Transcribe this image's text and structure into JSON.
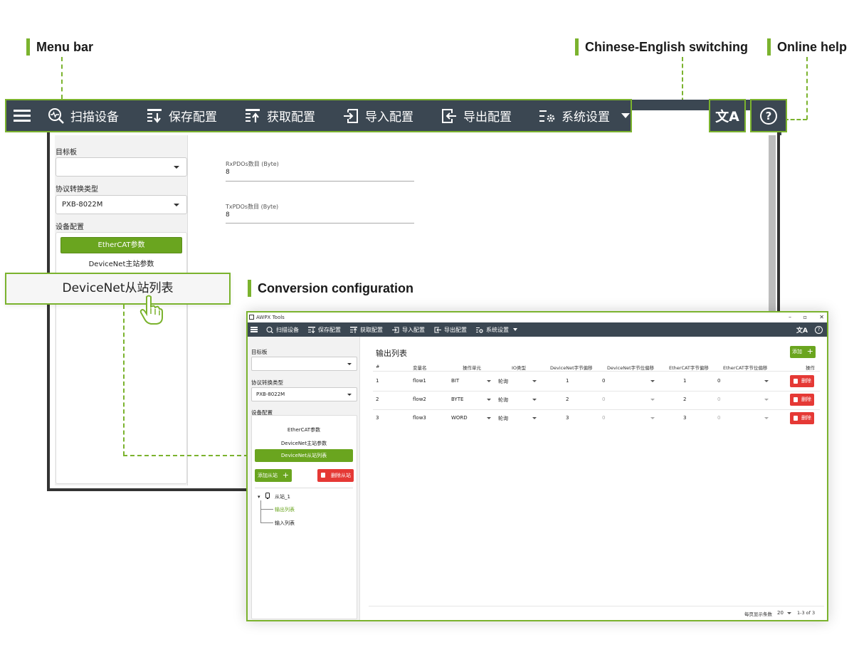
{
  "annotations": {
    "menu_bar": "Menu bar",
    "language": "Chinese-English switching",
    "help": "Online help",
    "conversion": "Conversion configuration"
  },
  "toolbar": {
    "items": [
      "扫描设备",
      "保存配置",
      "获取配置",
      "导入配置",
      "导出配置",
      "系统设置"
    ],
    "translate_glyph": "文A",
    "help_glyph": "?"
  },
  "bg_window": {
    "target_label": "目标板",
    "protocol_label": "协议转换类型",
    "protocol_value": "PXB-8022M",
    "device_config_label": "设备配置",
    "ethercat_btn": "EtherCAT参数",
    "devicenet_master": "DeviceNet主站参数",
    "rx_label": "RxPDOs数目 (Byte)",
    "rx_value": "8",
    "tx_label": "TxPDOs数目 (Byte)",
    "tx_value": "8"
  },
  "callout": {
    "label": "DeviceNet从站列表"
  },
  "inset": {
    "title": "AWPX Tools",
    "window_controls": [
      "–",
      "▫",
      "✕"
    ],
    "toolbar_items": [
      "扫描设备",
      "保存配置",
      "获取配置",
      "导入配置",
      "导出配置",
      "系统设置"
    ],
    "side": {
      "target_label": "目标板",
      "protocol_label": "协议转换类型",
      "protocol_value": "PXB-8022M",
      "device_config_label": "设备配置",
      "ethercat": "EtherCAT参数",
      "devicenet_master": "DeviceNet主站参数",
      "devicenet_slave_list": "DeviceNet从站列表",
      "add_slave": "添加从站",
      "delete_slave": "删除从站",
      "tree_root": "从站_1",
      "tree_output": "输出列表",
      "tree_input": "输入列表"
    },
    "main": {
      "title": "输出列表",
      "add_label": "添加",
      "headers": [
        "#",
        "变量名",
        "操作单元",
        "IO类型",
        "DeviceNet字节偏移",
        "DeviceNet字节位偏移",
        "EtherCAT字节偏移",
        "EtherCAT字节位偏移",
        "操作"
      ],
      "rows": [
        {
          "idx": "1",
          "name": "flow1",
          "unit": "BIT",
          "io": "轮询",
          "dn_byte": "1",
          "dn_bit": "0",
          "ec_byte": "1",
          "ec_bit": "0"
        },
        {
          "idx": "2",
          "name": "flow2",
          "unit": "BYTE",
          "io": "轮询",
          "dn_byte": "2",
          "dn_bit": "0",
          "ec_byte": "2",
          "ec_bit": "0"
        },
        {
          "idx": "3",
          "name": "flow3",
          "unit": "WORD",
          "io": "轮询",
          "dn_byte": "3",
          "dn_bit": "0",
          "ec_byte": "3",
          "ec_bit": "0"
        }
      ],
      "delete_label": "删除",
      "footer_rows_label": "每页显示条数",
      "footer_rows_value": "20",
      "footer_range": "1-3 of 3"
    }
  },
  "colors": {
    "accent": "#7bb32e",
    "bar": "#3b4752",
    "green_btn": "#6aa51f",
    "red_btn": "#e53935"
  }
}
